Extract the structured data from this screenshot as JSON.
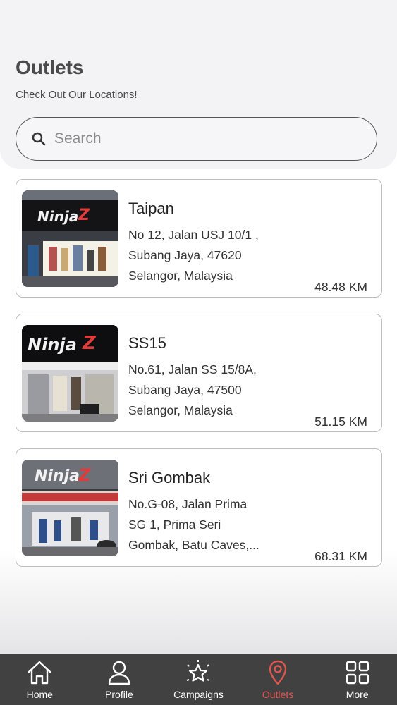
{
  "header": {
    "title": "Outlets",
    "subtitle": "Check Out Our Locations!"
  },
  "search": {
    "placeholder": "Search",
    "value": "",
    "icon": "search-icon"
  },
  "outlets": [
    {
      "name": "Taipan",
      "address_lines": [
        "No 12, Jalan USJ 10/1 ,",
        "Subang Jaya, 47620",
        "Selangor, Malaysia"
      ],
      "distance": "48.48 KM",
      "image_brand_text": "NinjaZ"
    },
    {
      "name": "SS15",
      "address_lines": [
        "No.61, Jalan SS 15/8A,",
        "Subang Jaya, 47500",
        "Selangor, Malaysia"
      ],
      "distance": "51.15 KM",
      "image_brand_text": "NinjaZ"
    },
    {
      "name": "Sri Gombak",
      "address_lines": [
        "No.G-08, Jalan Prima",
        "SG 1, Prima Seri",
        "Gombak, Batu Caves,..."
      ],
      "distance": "68.31 KM",
      "image_brand_text": "NinjaZ"
    }
  ],
  "tabbar": {
    "active": "Outlets",
    "active_color": "#e0564f",
    "items": [
      {
        "label": "Home",
        "icon": "home-icon"
      },
      {
        "label": "Profile",
        "icon": "user-icon"
      },
      {
        "label": "Campaigns",
        "icon": "campaign-star-icon"
      },
      {
        "label": "Outlets",
        "icon": "location-pin-icon"
      },
      {
        "label": "More",
        "icon": "grid-icon"
      }
    ]
  }
}
